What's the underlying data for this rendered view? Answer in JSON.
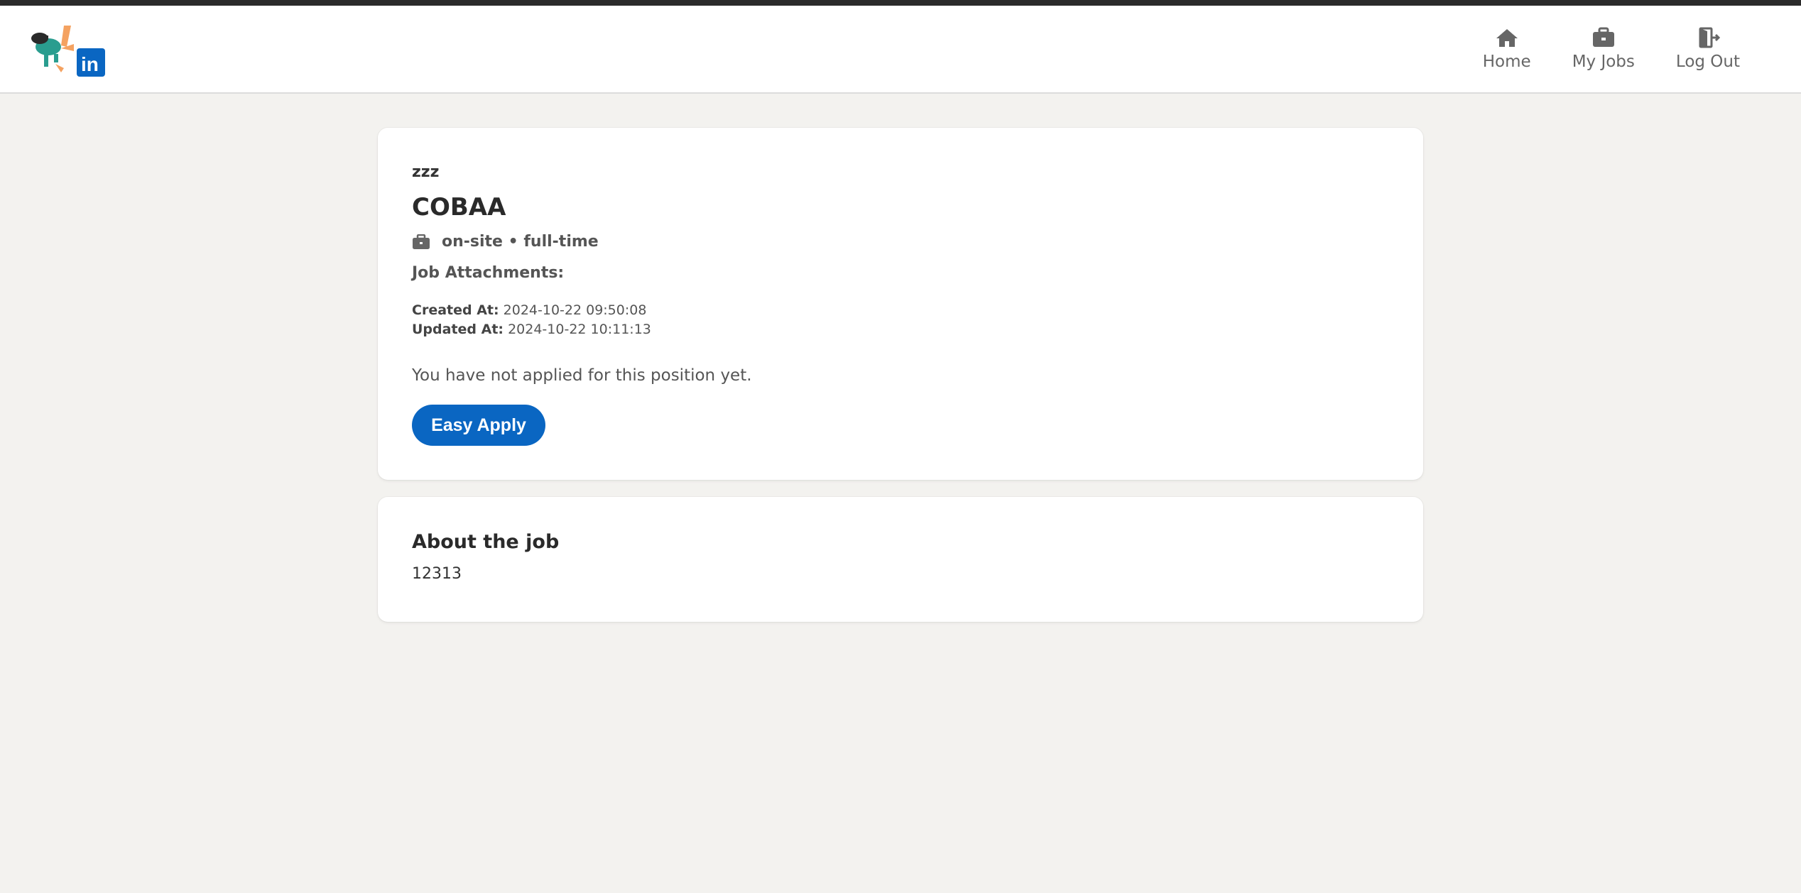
{
  "nav": {
    "items": [
      {
        "label": "Home",
        "icon": "home-icon"
      },
      {
        "label": "My Jobs",
        "icon": "briefcase-icon"
      },
      {
        "label": "Log Out",
        "icon": "logout-icon"
      }
    ]
  },
  "job": {
    "company": "zzz",
    "title": "COBAA",
    "work_type": "on-site • full-time",
    "attachments_label": "Job Attachments:",
    "created_label": "Created At:",
    "created_value": "2024-10-22 09:50:08",
    "updated_label": "Updated At:",
    "updated_value": "2024-10-22 10:11:13",
    "status_text": "You have not applied for this position yet.",
    "apply_label": "Easy Apply"
  },
  "about": {
    "title": "About the job",
    "body": "12313"
  },
  "colors": {
    "accent": "#0a66c2",
    "background": "#f3f2ef"
  }
}
